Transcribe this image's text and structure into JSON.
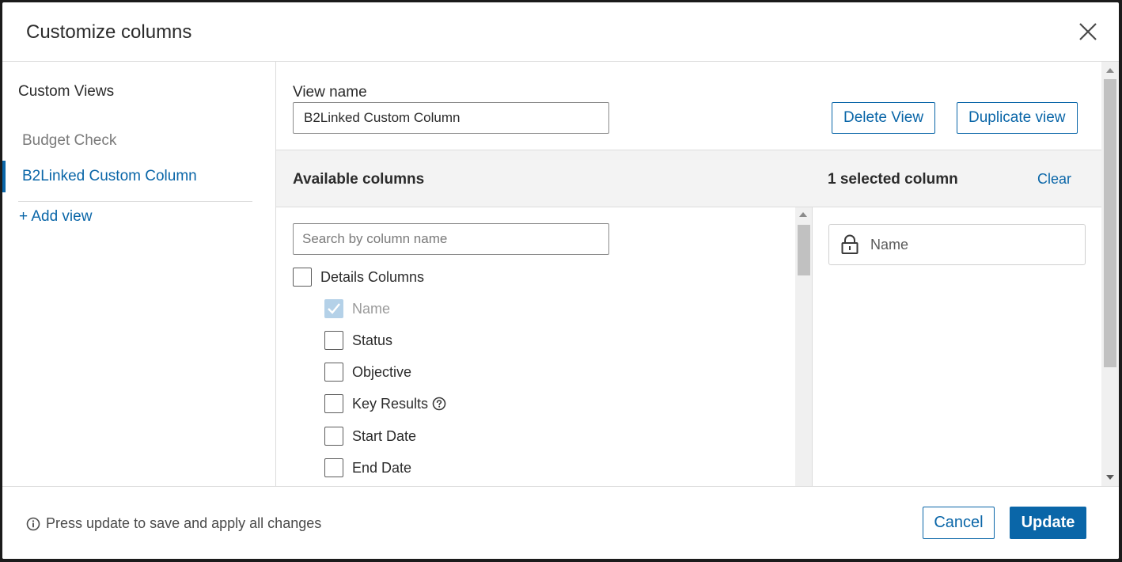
{
  "dialog": {
    "title": "Customize columns",
    "close_icon": "close-icon"
  },
  "sidebar": {
    "heading": "Custom Views",
    "items": [
      {
        "label": "Budget Check",
        "active": false
      },
      {
        "label": "B2Linked Custom Column",
        "active": true
      }
    ],
    "add_view": "+ Add view"
  },
  "view": {
    "name_label": "View name",
    "name_value": "B2Linked Custom Column",
    "delete_label": "Delete View",
    "duplicate_label": "Duplicate view"
  },
  "columns": {
    "available_heading": "Available columns",
    "selected_heading": "1 selected column",
    "clear_label": "Clear",
    "search_placeholder": "Search by column name",
    "groups": [
      {
        "label": "Details Columns",
        "checked": false,
        "items": [
          {
            "label": "Name",
            "checked": true,
            "disabled": true
          },
          {
            "label": "Status",
            "checked": false
          },
          {
            "label": "Objective",
            "checked": false
          },
          {
            "label": "Key Results",
            "checked": false,
            "help_icon": "question-circle-icon"
          },
          {
            "label": "Start Date",
            "checked": false
          },
          {
            "label": "End Date",
            "checked": false
          }
        ]
      }
    ],
    "selected": [
      {
        "label": "Name",
        "icon": "lock-icon"
      }
    ]
  },
  "footer": {
    "note": "Press update to save and apply all changes",
    "note_icon": "info-icon",
    "cancel_label": "Cancel",
    "update_label": "Update"
  },
  "colors": {
    "accent": "#0a66a8",
    "band_bg": "#f3f3f3",
    "checked_disabled": "#b4d1e8"
  }
}
